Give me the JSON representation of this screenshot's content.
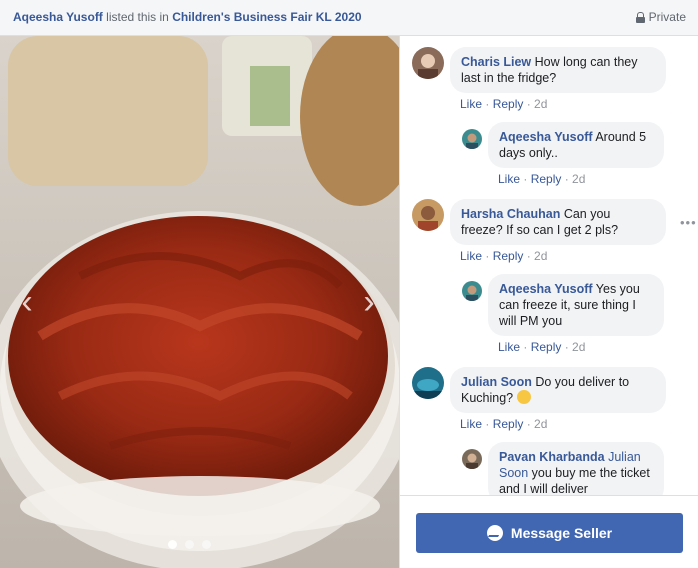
{
  "header": {
    "seller": "Aqeesha Yusoff",
    "listed_text": " listed this in ",
    "group": "Children's Business Fair KL 2020",
    "privacy": "Private",
    "privacy_icon": "lock-icon"
  },
  "photo": {
    "prev_arrow": "‹",
    "next_arrow": "›",
    "dots_count": 3,
    "active_dot": 0
  },
  "comments": [
    {
      "author": "Charis Liew",
      "text": " How long can they last in the fridge?",
      "like": "Like",
      "reply": "Reply",
      "time": "2d"
    },
    {
      "author": "Aqeesha Yusoff",
      "text": " Around 5 days only..",
      "like": "Like",
      "reply": "Reply",
      "time": "2d"
    },
    {
      "author": "Harsha Chauhan",
      "text": " Can you freeze? If so can I get 2 pls?",
      "like": "Like",
      "reply": "Reply",
      "time": "2d"
    },
    {
      "author": "Aqeesha Yusoff",
      "text": " Yes you can freeze it, sure thing I will PM you",
      "like": "Like",
      "reply": "Reply",
      "time": "2d"
    },
    {
      "author": "Julian Soon",
      "text": " Do you deliver to Kuching? ",
      "like": "Like",
      "reply": "Reply",
      "time": "2d"
    },
    {
      "author": "Pavan Kharbanda",
      "mention": " Julian Soon",
      "text": " you buy me the ticket and I will deliver"
    }
  ],
  "more_options": "•••",
  "footer": {
    "button_label": "Message Seller",
    "button_icon": "messenger-icon",
    "button_color": "#4267b2"
  }
}
